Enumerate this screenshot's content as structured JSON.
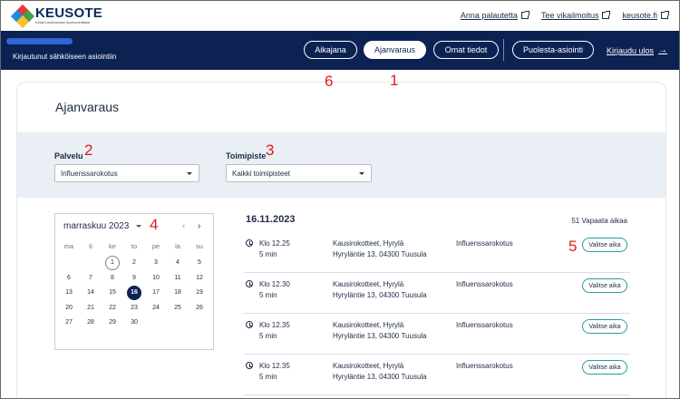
{
  "brand": {
    "name": "KEUSOTE",
    "subtitle": "Keski-Uudenmaan hyvinvointialue"
  },
  "top_links": [
    {
      "label": "Anna palautetta"
    },
    {
      "label": "Tee vikailmoitus"
    },
    {
      "label": "keusote.fi"
    }
  ],
  "nav": {
    "logged_in": "Kirjautunut sähköiseen asiointiin",
    "buttons": [
      {
        "label": "Aikajana"
      },
      {
        "label": "Ajanvaraus"
      },
      {
        "label": "Omat tiedot"
      },
      {
        "label": "Puolesta-asiointi"
      }
    ],
    "logout": "Kirjaudu ulos"
  },
  "annotations": [
    "1",
    "2",
    "3",
    "4",
    "5",
    "6"
  ],
  "page": {
    "title": "Ajanvaraus"
  },
  "filters": {
    "service": {
      "label": "Palvelu",
      "value": "Influenssarokotus"
    },
    "location": {
      "label": "Toimipiste",
      "value": "Kaikki toimipisteet"
    }
  },
  "calendar": {
    "month": "marraskuu 2023",
    "weekdays": [
      "ma",
      "ti",
      "ke",
      "to",
      "pe",
      "la",
      "su"
    ],
    "rows": [
      [
        "",
        "",
        "1",
        "2",
        "3",
        "4",
        "5"
      ],
      [
        "6",
        "7",
        "8",
        "9",
        "10",
        "11",
        "12"
      ],
      [
        "13",
        "14",
        "15",
        "16",
        "17",
        "18",
        "19"
      ],
      [
        "20",
        "21",
        "22",
        "23",
        "24",
        "25",
        "26"
      ],
      [
        "27",
        "28",
        "29",
        "30",
        "",
        "",
        ""
      ]
    ],
    "today": "1",
    "selected": "16"
  },
  "slots_header": {
    "date": "16.11.2023",
    "free": "51 Vapaata aikaa"
  },
  "slots": [
    {
      "time": "Klo 12.25",
      "duration": "5 min",
      "place": "Kausirokotteet, Hyrylä",
      "address": "Hyryläntie 13, 04300 Tuusula",
      "service": "Influenssarokotus",
      "button": "Valitse aika"
    },
    {
      "time": "Klo 12.30",
      "duration": "5 min",
      "place": "Kausirokotteet, Hyrylä",
      "address": "Hyryläntie 13, 04300 Tuusula",
      "service": "Influenssarokotus",
      "button": "Valitse aika"
    },
    {
      "time": "Klo 12.35",
      "duration": "5 min",
      "place": "Kausirokotteet, Hyrylä",
      "address": "Hyryläntie 13, 04300 Tuusula",
      "service": "Influenssarokotus",
      "button": "Valitse aika"
    },
    {
      "time": "Klo 12.35",
      "duration": "5 min",
      "place": "Kausirokotteet, Hyrylä",
      "address": "Hyryläntie 13, 04300 Tuusula",
      "service": "Influenssarokotus",
      "button": "Valitse aika"
    }
  ]
}
